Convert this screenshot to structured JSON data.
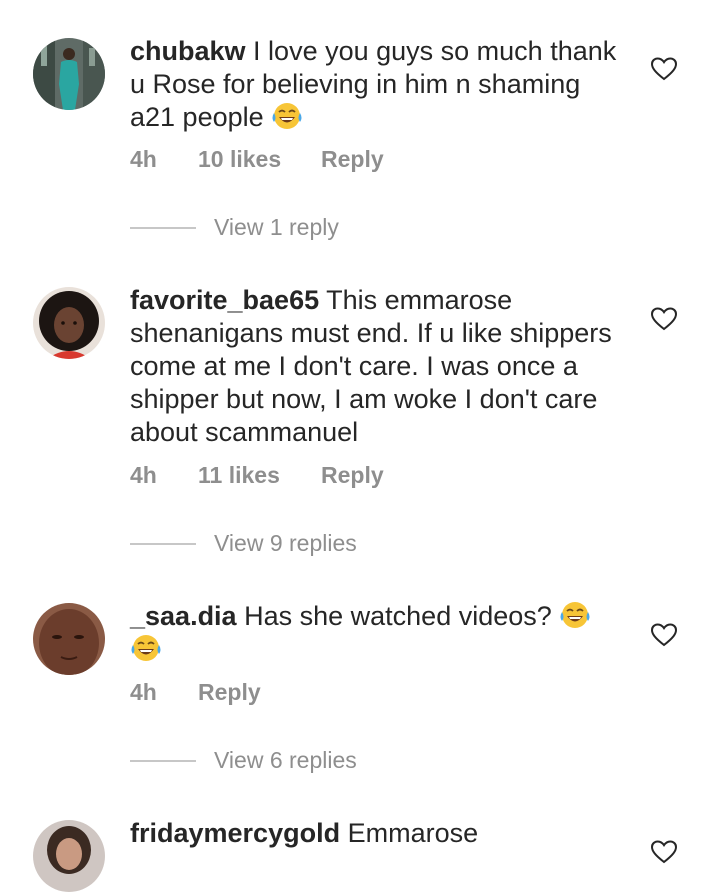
{
  "comments": [
    {
      "username": "chubakw",
      "text": "I love you guys so much thank u Rose for believing in him n shaming a21 people",
      "emoji": "face-with-tears-of-joy",
      "time": "4h",
      "likes": "10 likes",
      "reply_label": "Reply",
      "view_replies": "View 1 reply"
    },
    {
      "username": "favorite_bae65",
      "text": "This emmarose shenanigans must end. If u like shippers come at me I don't care. I was once a shipper but now, I am woke I don't care about scammanuel",
      "time": "4h",
      "likes": "11 likes",
      "reply_label": "Reply",
      "view_replies": "View 9 replies"
    },
    {
      "username": "_saa.dia",
      "text": "Has she watched videos?",
      "emoji": "face-with-tears-of-joy",
      "time": "4h",
      "reply_label": "Reply",
      "view_replies": "View 6 replies"
    },
    {
      "username": "fridaymercygold",
      "text": "Emmarose"
    }
  ],
  "icons": {
    "like": "heart-outline-icon",
    "emoji": "face-with-tears-of-joy-icon"
  },
  "colors": {
    "text": "#262626",
    "secondary": "#8e8e8e",
    "divider": "#c7c7c7"
  }
}
